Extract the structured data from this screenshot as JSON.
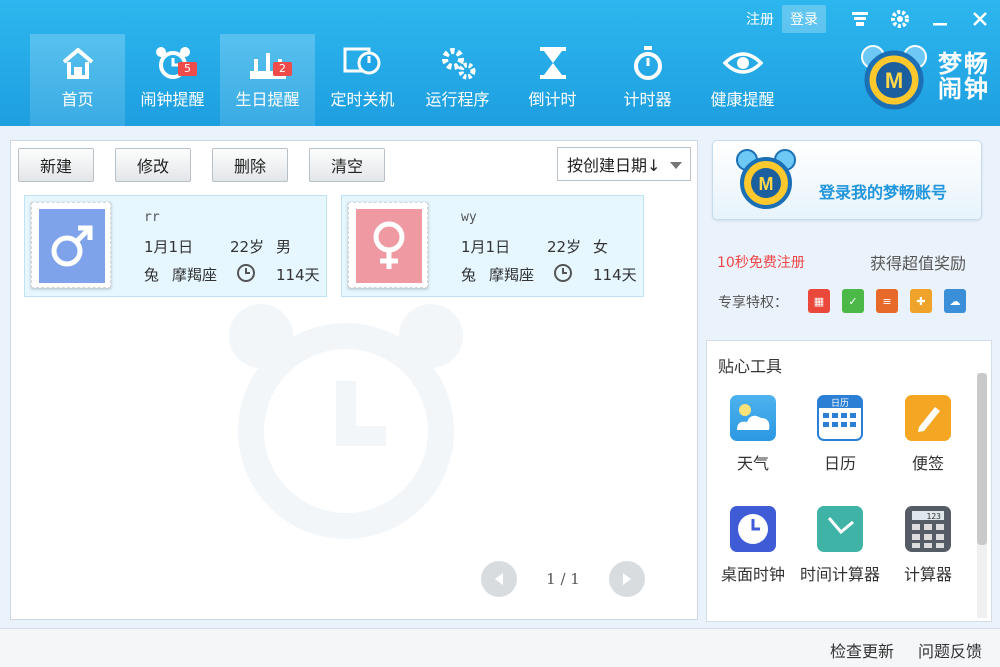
{
  "topbar": {
    "register": "注册",
    "login": "登录"
  },
  "nav": [
    {
      "label": "首页",
      "icon": "home-icon"
    },
    {
      "label": "闹钟提醒",
      "icon": "alarm-clock-icon",
      "badge": "5"
    },
    {
      "label": "生日提醒",
      "icon": "birthday-cake-icon",
      "badge": "2"
    },
    {
      "label": "定时关机",
      "icon": "power-icon"
    },
    {
      "label": "运行程序",
      "icon": "gears-icon"
    },
    {
      "label": "倒计时",
      "icon": "hourglass-icon"
    },
    {
      "label": "计时器",
      "icon": "stopwatch-icon"
    },
    {
      "label": "健康提醒",
      "icon": "eye-icon"
    }
  ],
  "logo": {
    "line1": "梦畅",
    "line2": "闹钟"
  },
  "toolbar": {
    "new": "新建",
    "edit": "修改",
    "delete": "删除",
    "clear": "清空",
    "sort": "按创建日期↓"
  },
  "cards": [
    {
      "name": "rr",
      "date": "1月1日",
      "age": "22岁",
      "gender": "男",
      "zodiac_animal": "兔",
      "zodiac_sign": "摩羯座",
      "days": "114天",
      "color": "#7fa3ea"
    },
    {
      "name": "wy",
      "date": "1月1日",
      "age": "22岁",
      "gender": "女",
      "zodiac_animal": "兔",
      "zodiac_sign": "摩羯座",
      "days": "114天",
      "color": "#ef9aa3"
    }
  ],
  "pager": {
    "text": "1 / 1"
  },
  "account": {
    "login_text": "登录我的梦畅账号",
    "register_link": "10秒免费注册",
    "reward": "获得超值奖励",
    "privilege_label": "专享特权："
  },
  "tools": {
    "title": "贴心工具",
    "items": [
      {
        "label": "天气",
        "icon": "weather-icon"
      },
      {
        "label": "日历",
        "icon": "calendar-icon",
        "glyph": "日历"
      },
      {
        "label": "便签",
        "icon": "note-icon"
      },
      {
        "label": "桌面时钟",
        "icon": "desktop-clock-icon"
      },
      {
        "label": "时间计算器",
        "icon": "time-calculator-icon"
      },
      {
        "label": "计算器",
        "icon": "calculator-icon",
        "glyph": "123"
      }
    ]
  },
  "status": {
    "check_update": "检查更新",
    "feedback": "问题反馈"
  }
}
